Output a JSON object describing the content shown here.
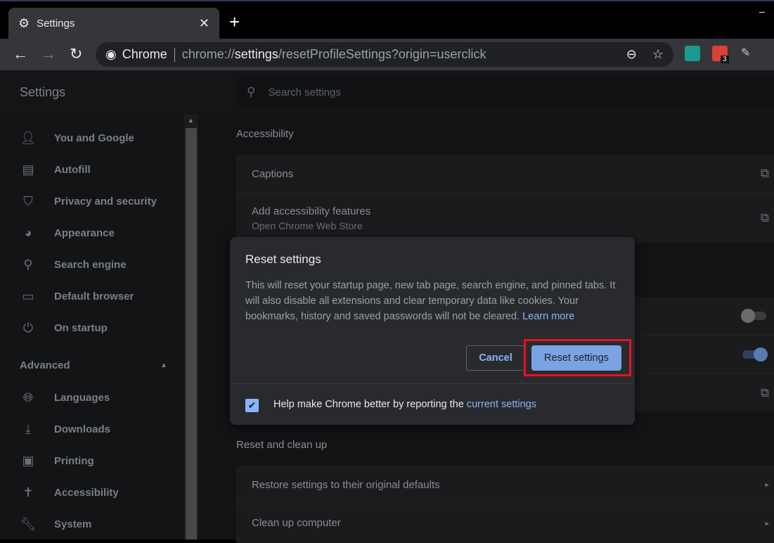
{
  "browser": {
    "tab_title": "Settings",
    "new_tab": "+",
    "close": "✕",
    "minimize": "–",
    "omnibox": {
      "chip": "Chrome",
      "url_prefix": "chrome://",
      "url_host": "settings",
      "url_path": "/resetProfileSettings?origin=userclick"
    },
    "extension_badge": "3"
  },
  "header": {
    "title": "Settings",
    "search_placeholder": "Search settings"
  },
  "sidebar": {
    "items": [
      {
        "label": "You and Google",
        "icon": "person-icon"
      },
      {
        "label": "Autofill",
        "icon": "clipboard-icon"
      },
      {
        "label": "Privacy and security",
        "icon": "shield-icon"
      },
      {
        "label": "Appearance",
        "icon": "palette-icon"
      },
      {
        "label": "Search engine",
        "icon": "search-icon"
      },
      {
        "label": "Default browser",
        "icon": "browser-icon"
      },
      {
        "label": "On startup",
        "icon": "power-icon"
      }
    ],
    "advanced": "Advanced",
    "advanced_items": [
      {
        "label": "Languages",
        "icon": "globe-icon"
      },
      {
        "label": "Downloads",
        "icon": "download-icon"
      },
      {
        "label": "Printing",
        "icon": "printer-icon"
      },
      {
        "label": "Accessibility",
        "icon": "accessibility-icon"
      },
      {
        "label": "System",
        "icon": "wrench-icon"
      }
    ]
  },
  "main": {
    "accessibility_heading": "Accessibility",
    "captions": "Captions",
    "add_features": "Add accessibility features",
    "add_features_sub": "Open Chrome Web Store",
    "toggles": {
      "first": false,
      "second": true
    },
    "reset_heading": "Reset and clean up",
    "restore": "Restore settings to their original defaults",
    "cleanup": "Clean up computer"
  },
  "dialog": {
    "title": "Reset settings",
    "body": "This will reset your startup page, new tab page, search engine, and pinned tabs. It will also disable all extensions and clear temporary data like cookies. Your bookmarks, history and saved passwords will not be cleared.",
    "learn_more": "Learn more",
    "cancel": "Cancel",
    "confirm": "Reset settings",
    "checkbox_checked": true,
    "checkbox_label": "Help make Chrome better by reporting the",
    "checkbox_link": "current settings"
  },
  "colors": {
    "accent": "#8ab4f8",
    "highlight": "#e81123",
    "dialog_bg": "#292a2d"
  }
}
